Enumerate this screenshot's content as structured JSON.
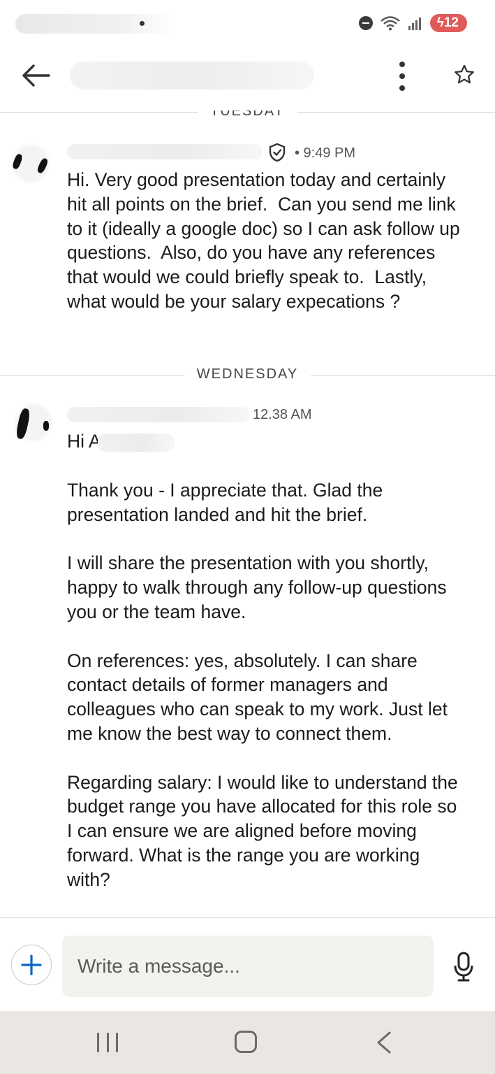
{
  "status_bar": {
    "battery": "12",
    "signal_glyph": "5G",
    "colors": {
      "battery_bg": "#e05a5a"
    }
  },
  "header": {
    "back_icon": "arrow-left-icon",
    "more_icon": "vertical-dots-icon",
    "star_icon": "star-outline-icon"
  },
  "conversation": {
    "days": [
      {
        "label": "TUESDAY",
        "message": {
          "time": "• 9:49 PM",
          "verified_icon": "shield-check-icon",
          "text": "Hi. Very good presentation today and certainly hit all points on the brief.  Can you send me link to it (ideally a google doc) so I can ask follow up questions.  Also, do you have any references that would we could briefly speak to.  Lastly, what would be your salary expecations ?"
        }
      },
      {
        "label": "WEDNESDAY",
        "message": {
          "time": "12.38 AM",
          "greeting": "Hi A",
          "text": "Thank you - I appreciate that. Glad the presentation landed and hit the brief.\n\nI will share the presentation with you shortly, happy to walk through any follow-up questions you or the team have.\n\nOn references: yes, absolutely. I can share contact details of former managers and colleagues who can speak to my work. Just let me know the best way to connect them.\n\nRegarding salary: I would like to understand the budget range you have allocated for this role so I can ensure we are aligned before moving forward. What is the range you are working with?"
        }
      }
    ]
  },
  "composer": {
    "placeholder": "Write a message...",
    "attach_icon": "plus-icon",
    "mic_icon": "microphone-icon",
    "colors": {
      "accent": "#0a66c2"
    }
  },
  "nav_bar": {
    "recent_icon": "recent-apps-icon",
    "home_icon": "home-icon",
    "back_icon": "back-chevron-icon"
  }
}
